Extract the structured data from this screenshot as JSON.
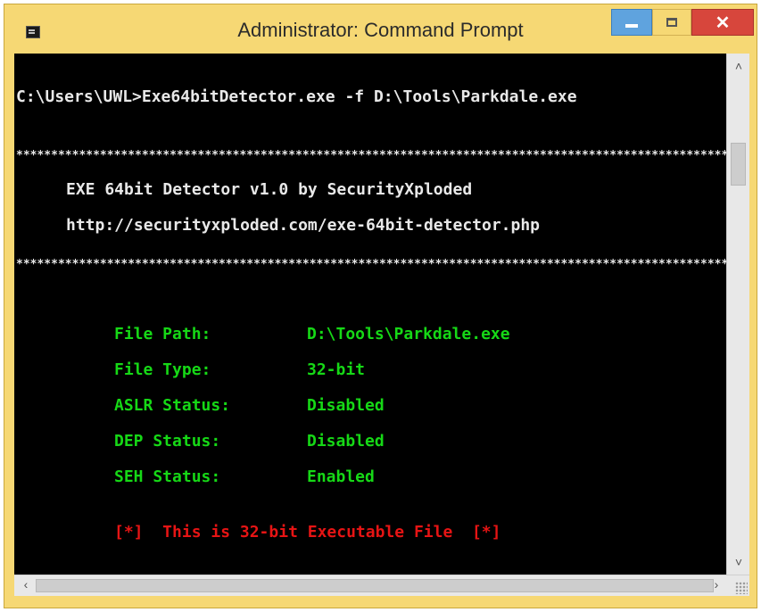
{
  "window": {
    "title": "Administrator: Command Prompt",
    "close_glyph": "✕"
  },
  "console": {
    "command": "C:\\Users\\UWL>Exe64bitDetector.exe -f D:\\Tools\\Parkdale.exe",
    "separator": "****************************************************************************************************************",
    "banner_title": "EXE 64bit Detector v1.0 by SecurityXploded",
    "banner_url": "http://securityxploded.com/exe-64bit-detector.php",
    "results": [
      {
        "label": "File Path:",
        "value": "D:\\Tools\\Parkdale.exe"
      },
      {
        "label": "File Type:",
        "value": "32-bit"
      },
      {
        "label": "ASLR Status:",
        "value": "Disabled"
      },
      {
        "label": "DEP Status:",
        "value": "Disabled"
      },
      {
        "label": "SEH Status:",
        "value": "Enabled"
      }
    ],
    "verdict": "[*]  This is 32-bit Executable File  [*]"
  },
  "colors": {
    "console_bg": "#000000",
    "text_white": "#e8e8e8",
    "text_green": "#16d816",
    "text_red": "#e61414",
    "titlebar": "#f6d874"
  },
  "icons": {
    "app": "cmd-icon",
    "minimize": "minimize-icon",
    "maximize": "maximize-icon",
    "close": "close-icon",
    "scroll_up": "chevron-up-icon",
    "scroll_down": "chevron-down-icon",
    "scroll_left": "chevron-left-icon",
    "scroll_right": "chevron-right-icon"
  }
}
